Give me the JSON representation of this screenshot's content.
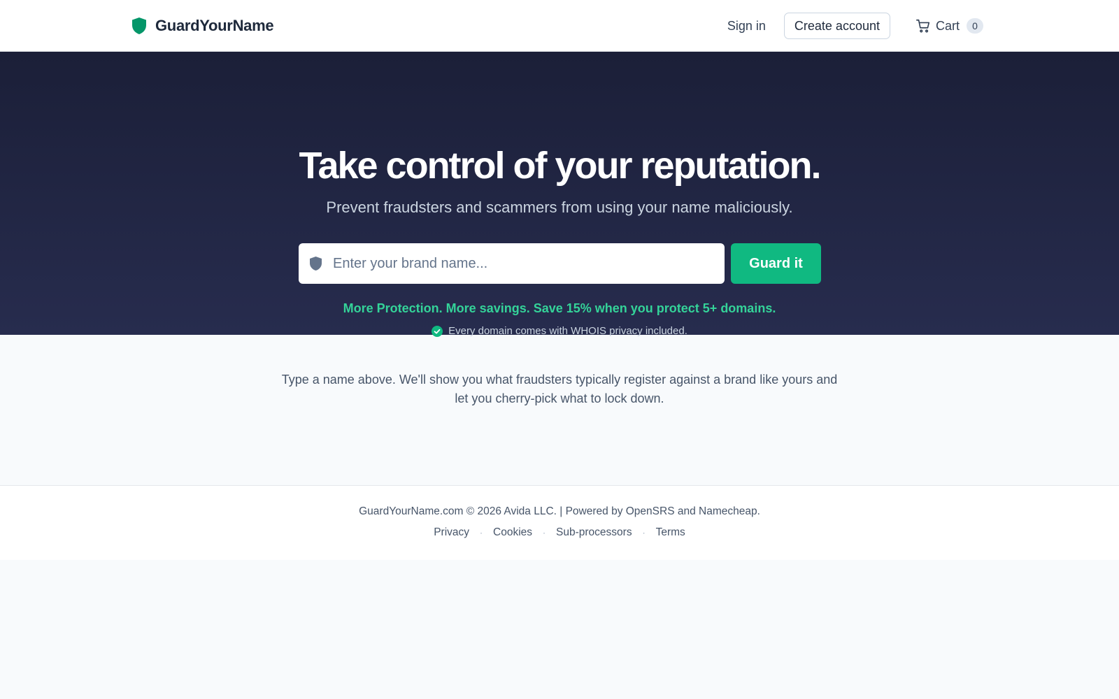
{
  "header": {
    "brand_name": "GuardYourName",
    "sign_in": "Sign in",
    "create_account": "Create account",
    "cart_label": "Cart",
    "cart_count": "0"
  },
  "hero": {
    "title": "Take control of your reputation.",
    "subtitle": "Prevent fraudsters and scammers from using your name maliciously.",
    "search_placeholder": "Enter your brand name...",
    "search_value": "",
    "guard_button": "Guard it",
    "promo": "More Protection. More savings. Save 15% when you protect 5+ domains.",
    "privacy_note": "Every domain comes with WHOIS privacy included."
  },
  "info": {
    "text": "Type a name above. We'll show you what fraudsters typically register against a brand like yours and let you cherry-pick what to lock down."
  },
  "footer": {
    "copyright": "GuardYourName.com © 2026 Avida LLC. | Powered by OpenSRS and Namecheap.",
    "links": [
      "Privacy",
      "Cookies",
      "Sub-processors",
      "Terms"
    ],
    "separator": "·"
  },
  "colors": {
    "accent": "#10b981",
    "promo": "#34d399",
    "hero_bg_top": "#1b1f38",
    "hero_bg_bottom": "#272c4e"
  },
  "icons": {
    "brand": "shield-icon",
    "search": "shield-icon",
    "cart": "cart-icon",
    "privacy": "check-circle-icon"
  }
}
